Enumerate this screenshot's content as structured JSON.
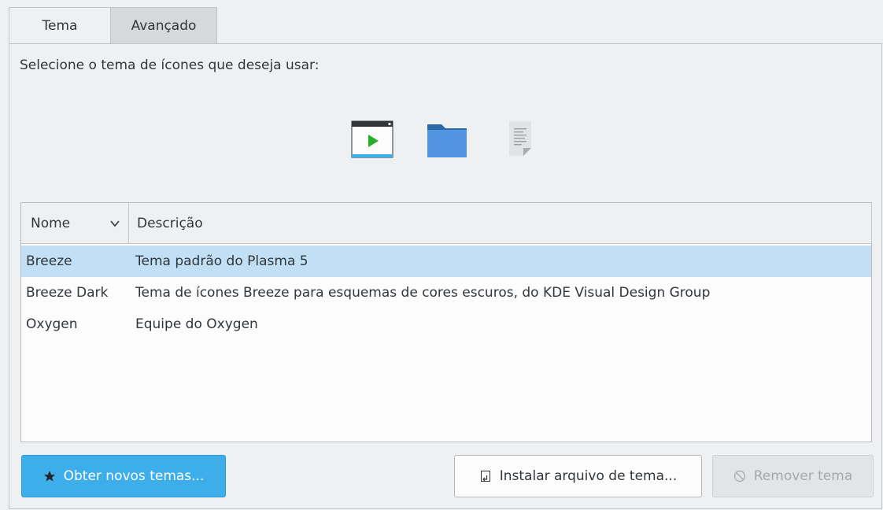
{
  "tabs": [
    {
      "label": "Tema",
      "active": true
    },
    {
      "label": "Avançado",
      "active": false
    }
  ],
  "prompt": "Selecione o tema de ícones que deseja usar:",
  "preview_icons": [
    "application-window-icon",
    "folder-icon",
    "text-document-icon"
  ],
  "list": {
    "headers": {
      "name": "Nome",
      "description": "Descrição"
    },
    "sort_indicator": "chevron-down-icon",
    "rows": [
      {
        "name": "Breeze",
        "description": "Tema padrão do Plasma 5",
        "selected": true
      },
      {
        "name": "Breeze Dark",
        "description": "Tema de ícones Breeze para esquemas de cores escuros, do KDE Visual Design Group",
        "selected": false
      },
      {
        "name": "Oxygen",
        "description": "Equipe do Oxygen",
        "selected": false
      }
    ]
  },
  "buttons": {
    "get_new": {
      "label": "Obter novos temas...",
      "icon": "star-icon"
    },
    "install": {
      "label": "Instalar arquivo de tema...",
      "icon": "install-file-icon"
    },
    "remove": {
      "label": "Remover tema",
      "icon": "cancel-icon",
      "enabled": false
    }
  },
  "colors": {
    "accent": "#3daee9",
    "selection": "#c2e0f5",
    "window_bg": "#eff0f1",
    "text": "#31363b"
  }
}
